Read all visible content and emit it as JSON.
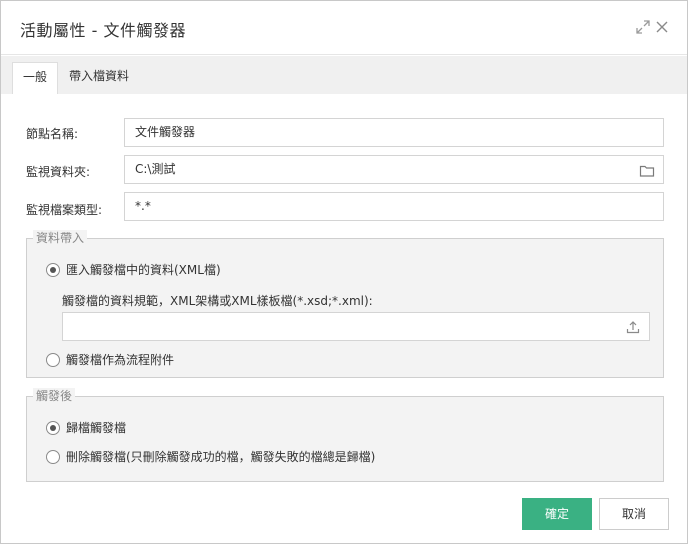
{
  "window": {
    "title": "活動屬性 - 文件觸發器",
    "expand_icon": "expand-arrows-icon",
    "close_icon": "close-icon"
  },
  "tabs": [
    {
      "label": "一般",
      "active": true
    },
    {
      "label": "帶入檔資料",
      "active": false
    }
  ],
  "form": {
    "node_name": {
      "label": "節點名稱:",
      "value": "文件觸發器"
    },
    "watch_folder": {
      "label": "監視資料夾:",
      "value": "C:\\測試",
      "icon": "folder-icon"
    },
    "file_type": {
      "label": "監視檔案類型:",
      "value": "*.*"
    }
  },
  "data_import": {
    "legend": "資料帶入",
    "option_import": {
      "label": "匯入觸發檔中的資料(XML檔)",
      "checked": true
    },
    "spec_hint": "觸發檔的資料規範，XML架構或XML樣板檔(*.xsd;*.xml):",
    "spec_value": "",
    "upload_icon": "upload-icon",
    "option_attach": {
      "label": "觸發檔作為流程附件",
      "checked": false
    }
  },
  "after_trigger": {
    "legend": "觸發後",
    "option_archive": {
      "label": "歸檔觸發檔",
      "checked": true
    },
    "option_delete": {
      "label": "刪除觸發檔(只刪除觸發成功的檔，觸發失敗的檔總是歸檔)",
      "checked": false
    }
  },
  "buttons": {
    "ok": "確定",
    "cancel": "取消"
  },
  "colors": {
    "primary": "#3ab183",
    "tab_bar": "#f0f0f0",
    "group_bg": "#f3f3f3"
  }
}
